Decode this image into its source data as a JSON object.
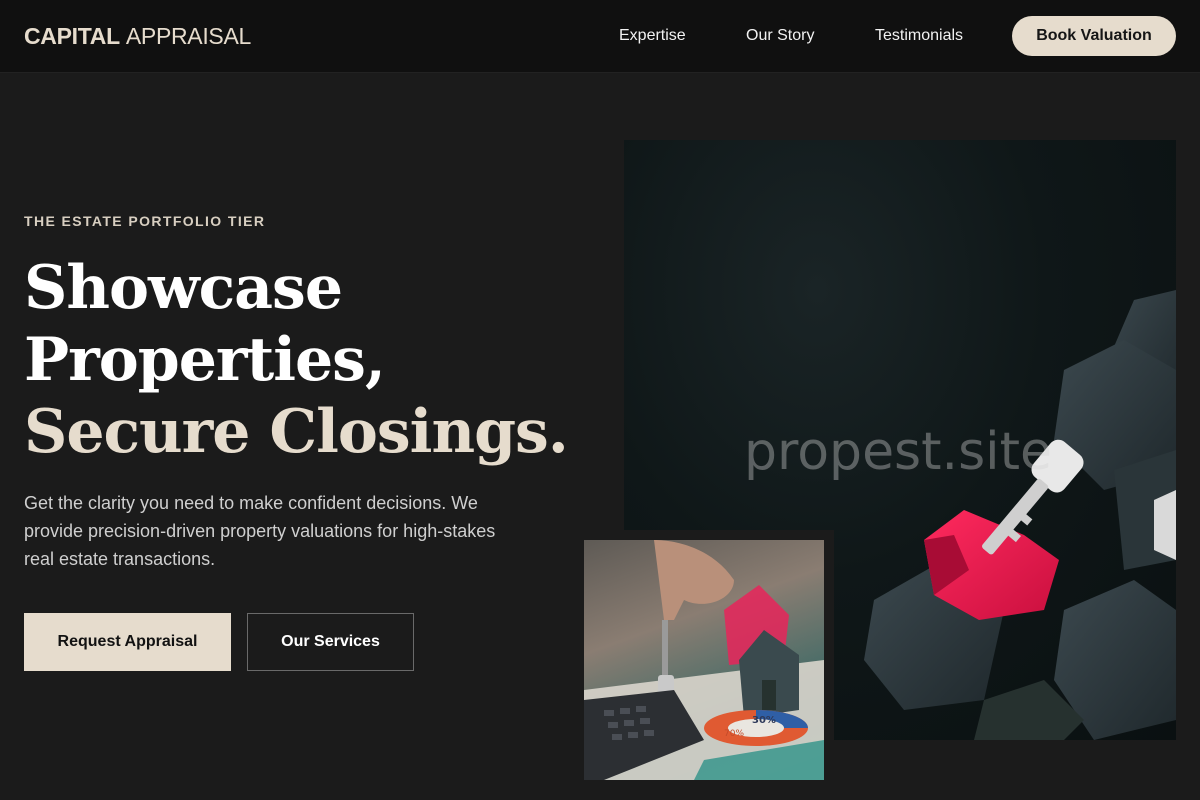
{
  "nav": {
    "brand_bold": "CAPITAL",
    "brand_light": "APPRAISAL",
    "links": [
      "Expertise",
      "Our Story",
      "Testimonials"
    ],
    "cta": "Book Valuation"
  },
  "hero": {
    "eyebrow": "THE ESTATE PORTFOLIO TIER",
    "headline_line1": "Showcase",
    "headline_line2": "Properties,",
    "headline_line3": "Secure Closings.",
    "lede": "Get the clarity you need to make confident decisions. We provide precision-driven property valuations for high-stakes real estate transactions.",
    "primary_button": "Request Appraisal",
    "secondary_button": "Our Services"
  },
  "media": {
    "main_watermark": "propest.site",
    "small_chart_label_1": "30%",
    "small_chart_label_2": "70%"
  },
  "colors": {
    "background": "#1b1b1b",
    "nav_background": "#101010",
    "accent": "#e6dccd",
    "house_pink": "#e8174a",
    "house_dark": "#2f3b40"
  }
}
